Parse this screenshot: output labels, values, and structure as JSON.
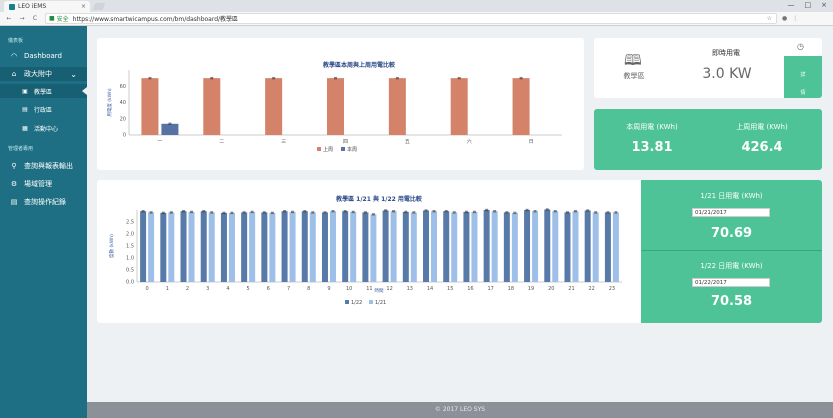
{
  "browser": {
    "tab_title": "LEO iEMS",
    "tab_close": "×",
    "back": "←",
    "forward": "→",
    "reload": "C",
    "secure_label": "安全",
    "url": "https://www.smartwicampus.com/bm/dashboard/教學區",
    "window_controls": [
      "—",
      "□",
      "×"
    ]
  },
  "sidebar": {
    "section1": "儀表板",
    "dashboard": "Dashboard",
    "group": "政大附中",
    "sub_items": [
      "教學區",
      "行政區",
      "活動中心"
    ],
    "section2": "管理者專用",
    "items2": [
      "查詢與報表輸出",
      "場域管理",
      "查詢操作紀錄"
    ]
  },
  "realtime": {
    "area_name": "教學區",
    "title": "即時用電",
    "value": "3.0 KW",
    "side_label": "詳情"
  },
  "week_summary": {
    "this_week_label": "本周用電 (KWh)",
    "this_week_value": "13.81",
    "last_week_label": "上周用電 (KWh)",
    "last_week_value": "426.4"
  },
  "day_summary": {
    "day1_label": "1/21 日用電 (KWh)",
    "day1_date": "01/21/2017",
    "day1_value": "70.69",
    "day2_label": "1/22 日用電 (KWh)",
    "day2_date": "01/22/2017",
    "day2_value": "70.58"
  },
  "footer": "© 2017 LEO SYS",
  "colors": {
    "sidebar": "#1e6f83",
    "green": "#4ec397",
    "last_week": "#d4826a",
    "this_week": "#5673a4",
    "day_22": "#587aa8",
    "day_21": "#9dbfe8"
  },
  "chart_data": [
    {
      "type": "bar",
      "title": "教學區本周與上周用電比較",
      "ylabel": "用電度 (kWh)",
      "categories": [
        "一",
        "二",
        "三",
        "四",
        "五",
        "六",
        "日"
      ],
      "ylim": [
        0,
        80
      ],
      "yticks": [
        0,
        20,
        40,
        60
      ],
      "series": [
        {
          "name": "上周",
          "values": [
            70,
            70,
            70,
            70,
            70,
            70,
            70
          ]
        },
        {
          "name": "本周",
          "values": [
            13.8,
            null,
            null,
            null,
            null,
            null,
            null
          ]
        }
      ],
      "legend": "bottom"
    },
    {
      "type": "bar",
      "title": "教學區 1/21 與 1/22 用電比較",
      "ylabel": "度數 (kWh)",
      "xlabel": "時間",
      "categories": [
        "0",
        "1",
        "2",
        "3",
        "4",
        "5",
        "6",
        "7",
        "8",
        "9",
        "10",
        "11",
        "12",
        "13",
        "14",
        "15",
        "16",
        "17",
        "18",
        "19",
        "20",
        "21",
        "22",
        "23"
      ],
      "ylim": [
        0,
        3.0
      ],
      "yticks": [
        0.0,
        0.5,
        1.0,
        1.5,
        2.0,
        2.5
      ],
      "series": [
        {
          "name": "1/22",
          "values": [
            2.95,
            2.88,
            2.95,
            2.95,
            2.88,
            2.9,
            2.9,
            2.95,
            2.95,
            2.9,
            2.95,
            2.9,
            2.98,
            2.92,
            2.98,
            2.95,
            2.92,
            3.0,
            2.9,
            3.0,
            3.02,
            2.9,
            2.98,
            2.9
          ]
        },
        {
          "name": "1/21",
          "values": [
            2.9,
            2.9,
            2.92,
            2.9,
            2.88,
            2.92,
            2.88,
            2.92,
            2.9,
            2.95,
            2.92,
            2.82,
            2.95,
            2.9,
            2.95,
            2.9,
            2.92,
            2.95,
            2.88,
            2.95,
            2.95,
            2.95,
            2.9,
            2.9
          ]
        }
      ],
      "legend": "bottom"
    }
  ]
}
